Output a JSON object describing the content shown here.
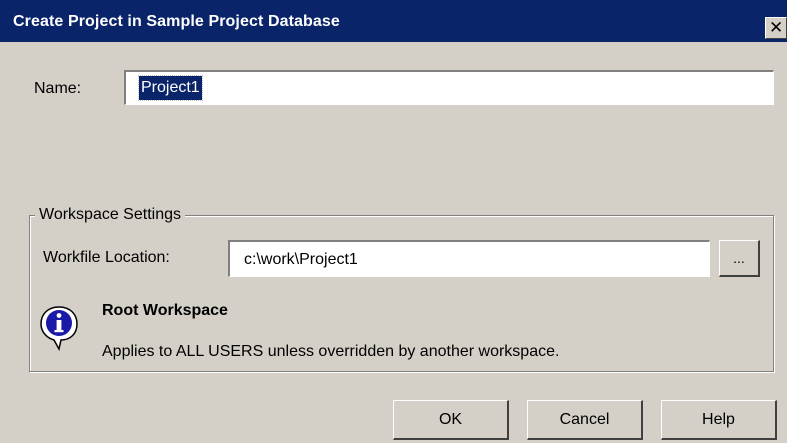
{
  "window": {
    "title": "Create Project in Sample Project Database",
    "close_glyph": "✕"
  },
  "form": {
    "name_label": "Name:",
    "name_value": "Project1"
  },
  "workspace": {
    "group_label": "Workspace Settings",
    "location_label": "Workfile Location:",
    "location_value": "c:\\work\\Project1",
    "browse_label": "...",
    "info_title": "Root Workspace",
    "info_desc": "Applies to ALL USERS unless overridden by another workspace."
  },
  "buttons": {
    "ok": "OK",
    "cancel": "Cancel",
    "help": "Help"
  },
  "icons": {
    "info": "info-icon"
  },
  "colors": {
    "titlebar": "#0a246a",
    "dialog_bg": "#d4d0c8",
    "selection": "#0a246a",
    "info_icon_fill": "#1a1aa8"
  }
}
